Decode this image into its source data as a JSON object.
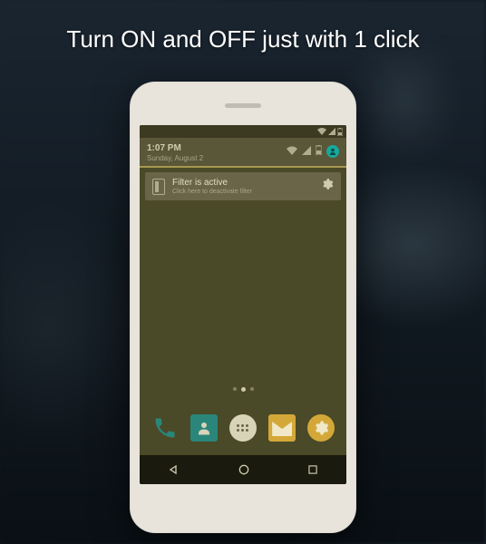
{
  "headline": "Turn ON and OFF just with 1 click",
  "status_bar": {
    "time": "1:07 PM",
    "date": "Sunday, August 2"
  },
  "notification": {
    "title": "Filter is active",
    "subtitle": "Click here to deactivate filter"
  },
  "dock": {
    "phone": "phone",
    "contacts": "contacts",
    "apps": "apps",
    "messages": "messages",
    "settings": "settings"
  },
  "colors": {
    "overlay": "#4a4a28",
    "accent": "#1aa89c"
  }
}
